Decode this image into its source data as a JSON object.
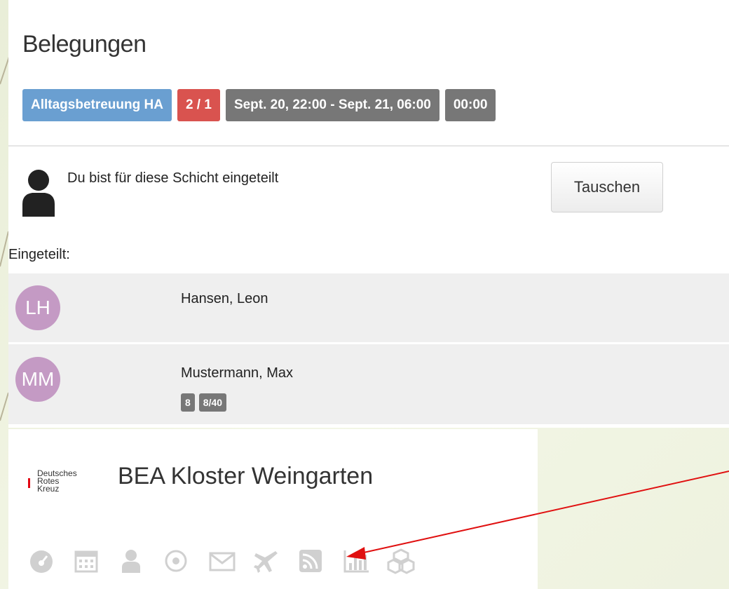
{
  "page": {
    "title": "Belegungen",
    "badges": {
      "category": "Alltagsbetreuung HA",
      "count": "2 / 1",
      "timerange": "Sept. 20, 22:00 - Sept. 21, 06:00",
      "duration": "00:00"
    }
  },
  "assignment": {
    "message": "Du bist für diese Schicht eingeteilt",
    "swap_button": "Tauschen"
  },
  "assigned": {
    "label": "Eingeteilt:",
    "people": [
      {
        "initials": "LH",
        "name": "Hansen, Leon",
        "badges": []
      },
      {
        "initials": "MM",
        "name": "Mustermann, Max",
        "badges": [
          "8",
          "8/40"
        ]
      }
    ]
  },
  "organization": {
    "logo_lines": [
      "Deutsches",
      "Rotes",
      "Kreuz"
    ],
    "name": "BEA Kloster Weingarten"
  },
  "nav_icons": [
    "dashboard-icon",
    "calendar-icon",
    "user-icon",
    "target-icon",
    "mail-icon",
    "plane-icon",
    "rss-icon",
    "chart-icon",
    "cubes-icon"
  ],
  "colors": {
    "blue_badge": "#6a9fd1",
    "red_badge": "#d9534f",
    "gray_badge": "#777777",
    "avatar": "#c49ac4",
    "annotation_arrow": "#e01010"
  }
}
